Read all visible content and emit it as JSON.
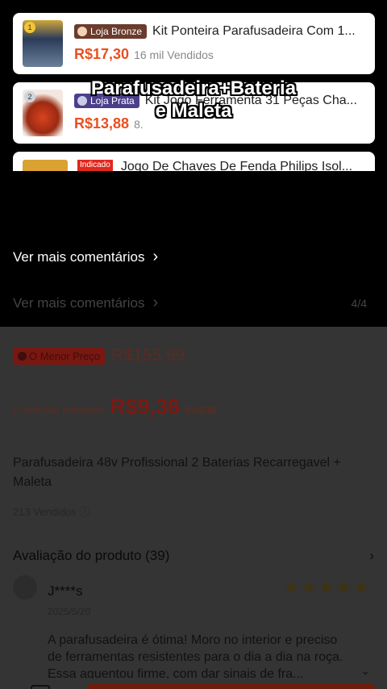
{
  "products": [
    {
      "store": "Loja Bronze",
      "title": "Kit Ponteira Parafusadeira Com 1...",
      "price": "R$17,30",
      "sold": "16 mil Vendidos",
      "badge_num": "1"
    },
    {
      "store": "Loja Prata",
      "title": "Kit Jogo Ferramenta 31 Peças Cha...",
      "price": "R$13,88",
      "sold": "8.",
      "badge_num": "2"
    },
    {
      "tag": "Indicado",
      "title": "Jogo De Chaves De Fenda Philips Isol..."
    }
  ],
  "caption": {
    "line1": "Parafusadeira+Bateria",
    "line2": "e Maleta"
  },
  "comments": {
    "more_label": "Ver mais comentários",
    "more_label_dim": "Ver mais comentários",
    "page_indicator": "4/4"
  },
  "product_page": {
    "low_price_badge": "O Menor Preço",
    "price": "R$155,99",
    "commission_label": "Comissão estimada",
    "commission_value": "R$9,36",
    "commission_pct": "6%CM",
    "name": "Parafusadeira 48v Profissional 2 Baterias Recarregavel  + Maleta",
    "sold": "213 Vendidos",
    "reviews_header": "Avaliação do produto (39)",
    "review": {
      "name": "J****s",
      "date": "2025/5/20",
      "text": "A parafusadeira é ótima! Moro no interior e preciso de ferramentas resistentes para o dia a dia na roça. Essa aguentou firme, com dar sinais de fra..."
    }
  },
  "colors": {
    "price_orange": "#e8501f",
    "store_badge_bronze": "#6b3b2c",
    "overlay_black": "#000000",
    "dim_page": "#343434"
  }
}
